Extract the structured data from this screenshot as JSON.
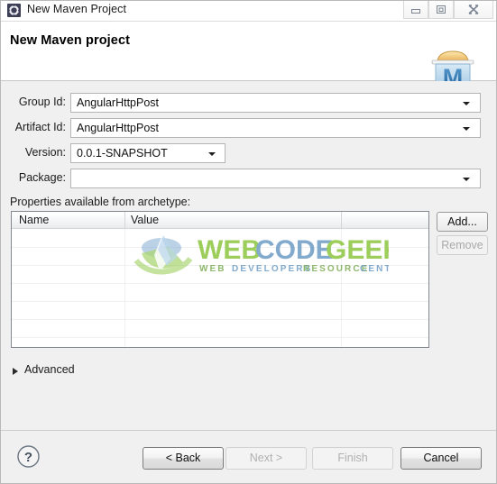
{
  "window": {
    "title": "New Maven Project",
    "app_icon": "maven-gear-icon",
    "controls": {
      "minimize": "minimize-icon",
      "maximize": "restore-icon",
      "close": "close-icon"
    }
  },
  "header": {
    "title": "New Maven project",
    "icon": "maven-archive-icon"
  },
  "form": {
    "fields": [
      {
        "label": "Group Id:",
        "value": "AngularHttpPost",
        "placeholder": "",
        "kind": "combo-wide"
      },
      {
        "label": "Artifact Id:",
        "value": "AngularHttpPost",
        "placeholder": "",
        "kind": "combo-wide"
      },
      {
        "label": "Version:",
        "value": "0.0.1-SNAPSHOT",
        "placeholder": "",
        "kind": "combo-small"
      },
      {
        "label": "Package:",
        "value": "",
        "placeholder": "",
        "kind": "combo-wide"
      }
    ]
  },
  "properties": {
    "section_label": "Properties available from archetype:",
    "columns": [
      "Name",
      "Value"
    ],
    "rows": [],
    "add_button": "Add...",
    "remove_button": "Remove",
    "add_enabled": true,
    "remove_enabled": false
  },
  "advanced": {
    "label": "Advanced",
    "expanded": false,
    "arrow_icon": "chevron-right-icon"
  },
  "footer": {
    "help_icon": "help-circle-icon",
    "buttons": [
      {
        "label": "< Back",
        "enabled": true
      },
      {
        "label": "Next >",
        "enabled": false
      },
      {
        "label": "Finish",
        "enabled": false
      },
      {
        "label": "Cancel",
        "enabled": true
      }
    ]
  },
  "watermark": {
    "word1": "WEB",
    "word2": "CODE",
    "word3": "GEEKS",
    "tagline": "WEB DEVELOPERS RESOURCE CENTER",
    "color_green": "#8cc63f",
    "color_blue": "#5b9bd5"
  },
  "colors": {
    "dialog_bg": "#f0f0f0",
    "header_bg": "#ffffff",
    "field_border": "#b4b4b4",
    "table_border": "#828790",
    "text": "#1a1a1a",
    "disabled_text": "#b0b0b0"
  }
}
